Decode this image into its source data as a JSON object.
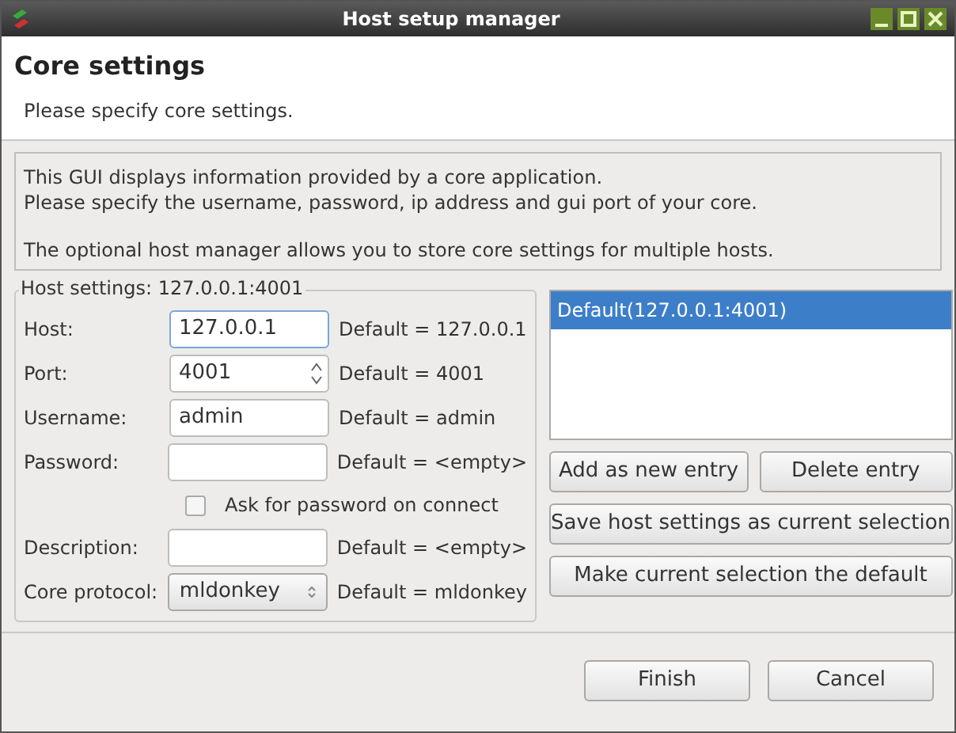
{
  "window": {
    "title": "Host setup manager"
  },
  "header": {
    "title": "Core settings",
    "subtitle": "Please specify core settings."
  },
  "info": [
    "This GUI displays information provided by a core application.",
    "Please specify the username, password, ip address and gui port of your core.",
    "The optional host manager allows you to store core settings for multiple hosts."
  ],
  "host_settings": {
    "title": "Host settings: 127.0.0.1:4001",
    "rows": [
      {
        "kind": "text",
        "label": "Host:",
        "value": "127.0.0.1",
        "focused": true,
        "default": "Default = 127.0.0.1"
      },
      {
        "kind": "spin",
        "label": "Port:",
        "value": "4001",
        "default": "Default = 4001"
      },
      {
        "kind": "text",
        "label": "Username:",
        "value": "admin",
        "default": "Default = admin"
      },
      {
        "kind": "text",
        "label": "Password:",
        "default": "Default = <empty>"
      },
      {
        "kind": "checkbox",
        "label": "Ask for password on connect",
        "checked": false
      },
      {
        "kind": "text",
        "label": "Description:",
        "default": "Default = <empty>"
      },
      {
        "kind": "combo",
        "label": "Core protocol:",
        "value": "mldonkey",
        "default": "Default = mldonkey"
      }
    ]
  },
  "hosts": [
    {
      "label": "Default(127.0.0.1:4001)",
      "selected": true
    }
  ],
  "host_buttons": [
    "Add as new entry",
    "Delete entry",
    "Save host settings as current selection",
    "Make current selection the default"
  ],
  "buttons": [
    "Finish",
    "Cancel"
  ]
}
